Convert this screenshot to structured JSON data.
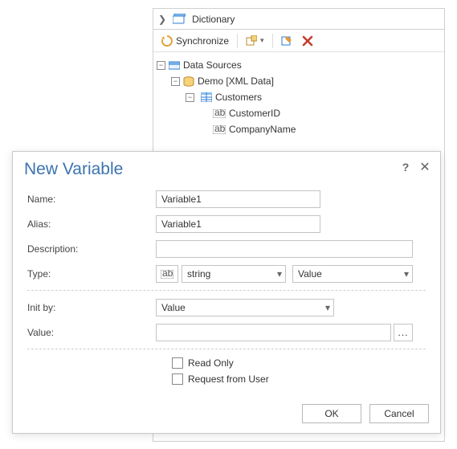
{
  "dictionary": {
    "title": "Dictionary",
    "toolbar": {
      "synchronize": "Synchronize"
    },
    "tree": {
      "root": "Data Sources",
      "demo": "Demo [XML Data]",
      "customers": "Customers",
      "customerId": "CustomerID",
      "companyName": "CompanyName"
    }
  },
  "dialog": {
    "title": "New Variable",
    "labels": {
      "name": "Name:",
      "alias": "Alias:",
      "description": "Description:",
      "type": "Type:",
      "initBy": "Init by:",
      "value": "Value:",
      "readOnly": "Read Only",
      "requestFromUser": "Request from User"
    },
    "values": {
      "name": "Variable1",
      "alias": "Variable1",
      "description": "",
      "type": "string",
      "typeMode": "Value",
      "initBy": "Value",
      "value": ""
    },
    "buttons": {
      "ok": "OK",
      "cancel": "Cancel"
    }
  }
}
